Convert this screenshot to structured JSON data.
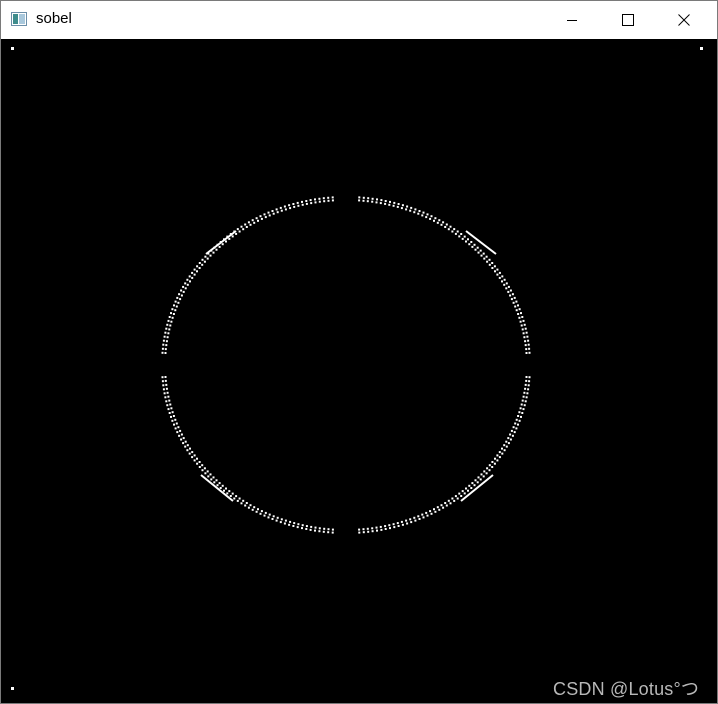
{
  "window": {
    "title": "sobel",
    "icon": "app-window-icon",
    "controls": {
      "minimize_icon": "minimize-icon",
      "maximize_icon": "maximize-icon",
      "close_icon": "close-icon"
    }
  },
  "image": {
    "background": "#000000",
    "edge_color": "#ffffff",
    "content": "sobel-edge-ellipse"
  },
  "watermark": {
    "text": "CSDN @Lotus°つ",
    "color": "#b8b8b8"
  }
}
